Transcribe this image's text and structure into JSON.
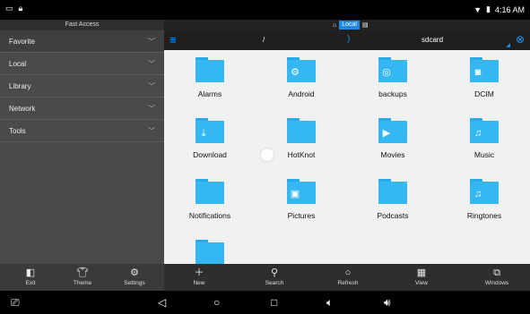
{
  "status_bar": {
    "time": "4:16 AM",
    "left_icons": [
      "screen-icon",
      "lock-icon"
    ],
    "right_icons": [
      "wifi-icon",
      "battery-icon"
    ]
  },
  "sidebar": {
    "title": "Fast Access",
    "items": [
      {
        "label": "Favorite"
      },
      {
        "label": "Local"
      },
      {
        "label": "Library"
      },
      {
        "label": "Network"
      },
      {
        "label": "Tools"
      }
    ]
  },
  "tab_strip": {
    "active": "Local"
  },
  "pathbar": {
    "root": "/",
    "current": "sdcard"
  },
  "folders": [
    {
      "name": "Alarms",
      "icon": "none"
    },
    {
      "name": "Android",
      "icon": "gear"
    },
    {
      "name": "backups",
      "icon": "backup"
    },
    {
      "name": "DCIM",
      "icon": "camera"
    },
    {
      "name": "Download",
      "icon": "download"
    },
    {
      "name": "HotKnot",
      "icon": "none"
    },
    {
      "name": "Movies",
      "icon": "play"
    },
    {
      "name": "Music",
      "icon": "music"
    },
    {
      "name": "Notifications",
      "icon": "none"
    },
    {
      "name": "Pictures",
      "icon": "image"
    },
    {
      "name": "Podcasts",
      "icon": "none"
    },
    {
      "name": "Ringtones",
      "icon": "music"
    },
    {
      "name": "",
      "icon": "none"
    }
  ],
  "toolbar": {
    "left": [
      {
        "label": "Exit",
        "icon": "exit-icon"
      },
      {
        "label": "Theme",
        "icon": "shirt-icon"
      },
      {
        "label": "Settings",
        "icon": "gear-icon"
      }
    ],
    "right": [
      {
        "label": "New",
        "icon": "plus-icon"
      },
      {
        "label": "Search",
        "icon": "search-icon"
      },
      {
        "label": "Refresh",
        "icon": "refresh-icon"
      },
      {
        "label": "View",
        "icon": "grid-icon"
      },
      {
        "label": "Windows",
        "icon": "windows-icon"
      }
    ]
  },
  "nav_bar": {
    "buttons": [
      "screenshot-icon",
      "back-icon",
      "home-icon",
      "recents-icon",
      "volume-down-icon",
      "volume-up-icon"
    ]
  },
  "colors": {
    "accent": "#2196f3",
    "folder": "#35b8f2",
    "sidebar_bg": "#4a4a4a",
    "grid_bg": "#f1f1f1"
  }
}
